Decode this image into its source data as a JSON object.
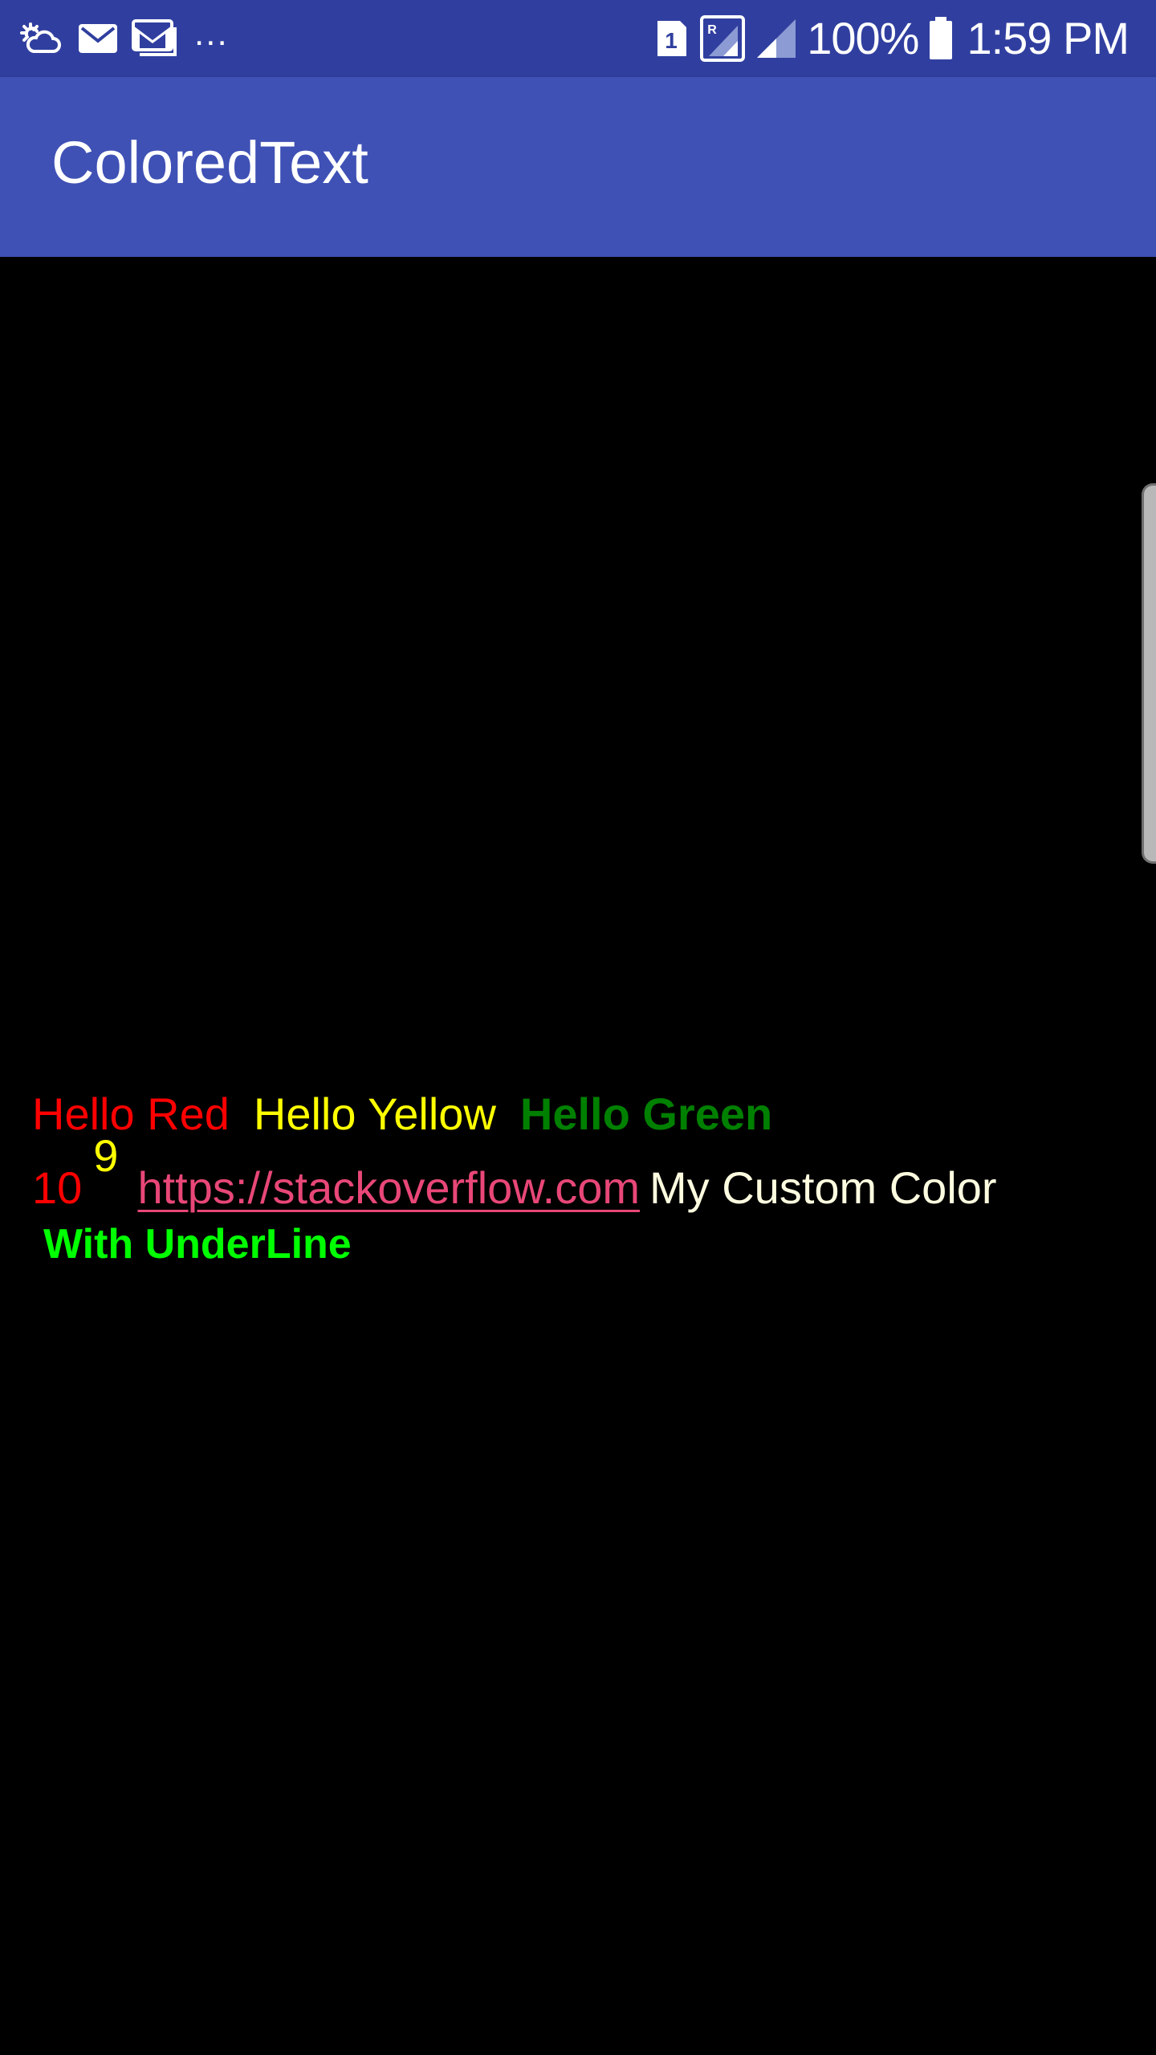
{
  "status_bar": {
    "left_icons": [
      "weather-cloud-sun-icon",
      "email-icon",
      "gmail-icon"
    ],
    "more": "...",
    "right_icons": [
      "sim-1-icon",
      "signal-roaming-icon",
      "signal-icon",
      "battery-icon"
    ],
    "sim_number": "1",
    "roaming_letter": "R",
    "battery_percent": "100%",
    "time": "1:59 PM"
  },
  "app_bar": {
    "title": "ColoredText"
  },
  "content": {
    "hello_red": "Hello Red",
    "hello_yellow": "Hello Yellow",
    "hello_green": "Hello Green",
    "number_base": "10",
    "number_superscript": "9",
    "link": "https://stackoverflow.com",
    "custom_color": "My Custom Color",
    "underline_text": "With UnderLine"
  },
  "colors": {
    "status_bar": "#303f9f",
    "app_bar": "#3f51b5",
    "background": "#000000",
    "red": "#ff0000",
    "yellow": "#ffff00",
    "green": "#008000",
    "link": "#e84777",
    "custom": "#fffde0",
    "underline_green": "#00ff00"
  }
}
